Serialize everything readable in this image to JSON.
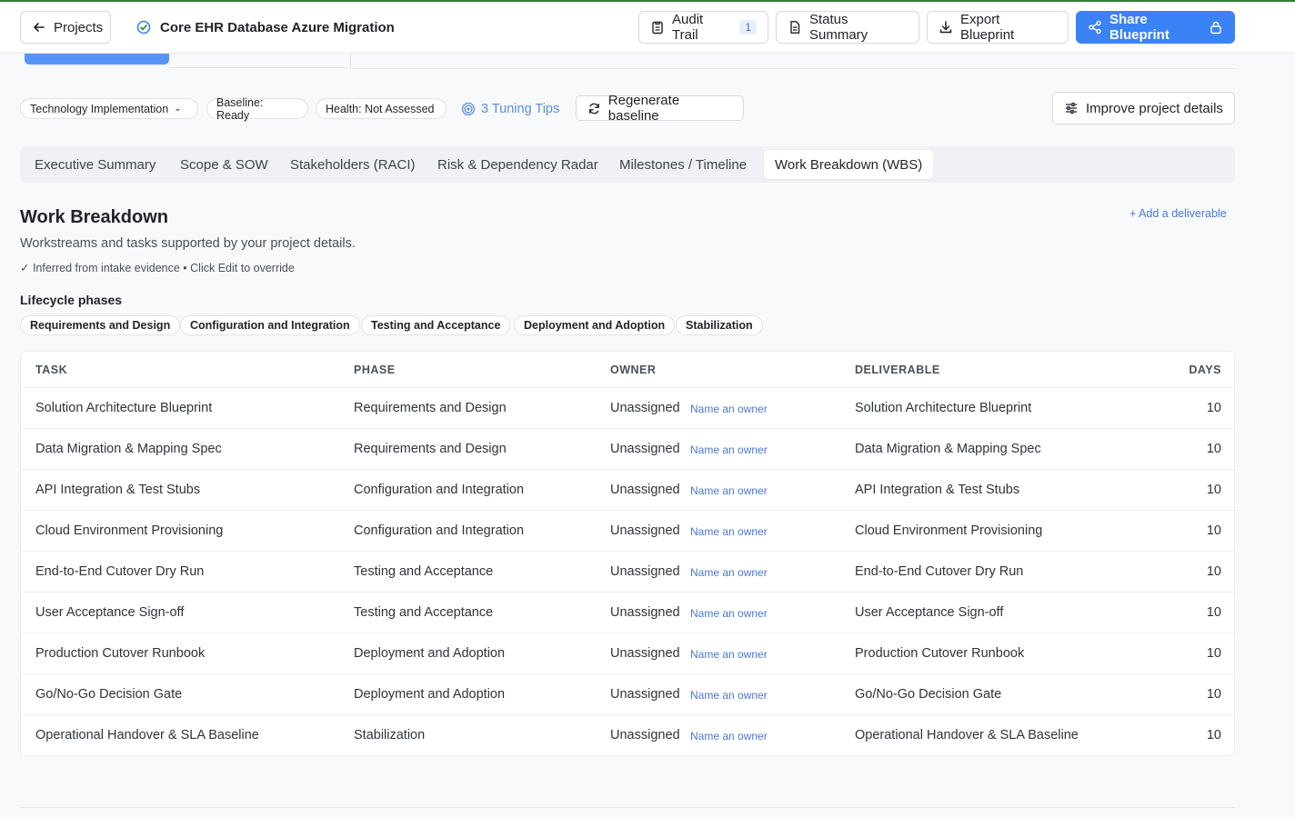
{
  "header": {
    "projects_label": "Projects",
    "project_title": "Core EHR Database Azure Migration",
    "audit_label": "Audit Trail",
    "audit_count": "1",
    "status_label": "Status Summary",
    "export_label": "Export Blueprint",
    "share_label": "Share Blueprint"
  },
  "toolbar": {
    "tech_pill": "Technology Implementation",
    "baseline_pill": "Baseline: Ready",
    "health_pill": "Health: Not Assessed",
    "tips_label": "3 Tuning Tips",
    "regen_label": "Regenerate baseline",
    "improve_label": "Improve project details"
  },
  "tabs": [
    {
      "label": "Executive Summary"
    },
    {
      "label": "Scope & SOW"
    },
    {
      "label": "Stakeholders (RACI)"
    },
    {
      "label": "Risk & Dependency Radar"
    },
    {
      "label": "Milestones / Timeline"
    },
    {
      "label": "Work Breakdown (WBS)"
    }
  ],
  "section": {
    "title": "Work Breakdown",
    "subtitle": "Workstreams and tasks supported by your project details.",
    "note": "✓ Inferred from intake evidence • Click Edit to override",
    "add_label": "+ Add a deliverable",
    "phases_title": "Lifecycle phases",
    "phases": [
      "Requirements and Design",
      "Configuration and Integration",
      "Testing and Acceptance",
      "Deployment and Adoption",
      "Stabilization"
    ]
  },
  "table": {
    "headers": {
      "task": "TASK",
      "phase": "PHASE",
      "owner": "OWNER",
      "deliverable": "DELIVERABLE",
      "days": "DAYS"
    },
    "name_owner_label": "Name an owner",
    "rows": [
      {
        "task": "Solution Architecture Blueprint",
        "phase": "Requirements and Design",
        "owner": "Unassigned",
        "deliverable": "Solution Architecture Blueprint",
        "days": "10"
      },
      {
        "task": "Data Migration & Mapping Spec",
        "phase": "Requirements and Design",
        "owner": "Unassigned",
        "deliverable": "Data Migration & Mapping Spec",
        "days": "10"
      },
      {
        "task": "API Integration & Test Stubs",
        "phase": "Configuration and Integration",
        "owner": "Unassigned",
        "deliverable": "API Integration & Test Stubs",
        "days": "10"
      },
      {
        "task": "Cloud Environment Provisioning",
        "phase": "Configuration and Integration",
        "owner": "Unassigned",
        "deliverable": "Cloud Environment Provisioning",
        "days": "10"
      },
      {
        "task": "End-to-End Cutover Dry Run",
        "phase": "Testing and Acceptance",
        "owner": "Unassigned",
        "deliverable": "End-to-End Cutover Dry Run",
        "days": "10"
      },
      {
        "task": "User Acceptance Sign-off",
        "phase": "Testing and Acceptance",
        "owner": "Unassigned",
        "deliverable": "User Acceptance Sign-off",
        "days": "10"
      },
      {
        "task": "Production Cutover Runbook",
        "phase": "Deployment and Adoption",
        "owner": "Unassigned",
        "deliverable": "Production Cutover Runbook",
        "days": "10"
      },
      {
        "task": "Go/No-Go Decision Gate",
        "phase": "Deployment and Adoption",
        "owner": "Unassigned",
        "deliverable": "Go/No-Go Decision Gate",
        "days": "10"
      },
      {
        "task": "Operational Handover & SLA Baseline",
        "phase": "Stabilization",
        "owner": "Unassigned",
        "deliverable": "Operational Handover & SLA Baseline",
        "days": "10"
      }
    ]
  },
  "colors": {
    "accent": "#3b82f6",
    "link": "#4a78d4",
    "topline": "#2e7d32"
  }
}
